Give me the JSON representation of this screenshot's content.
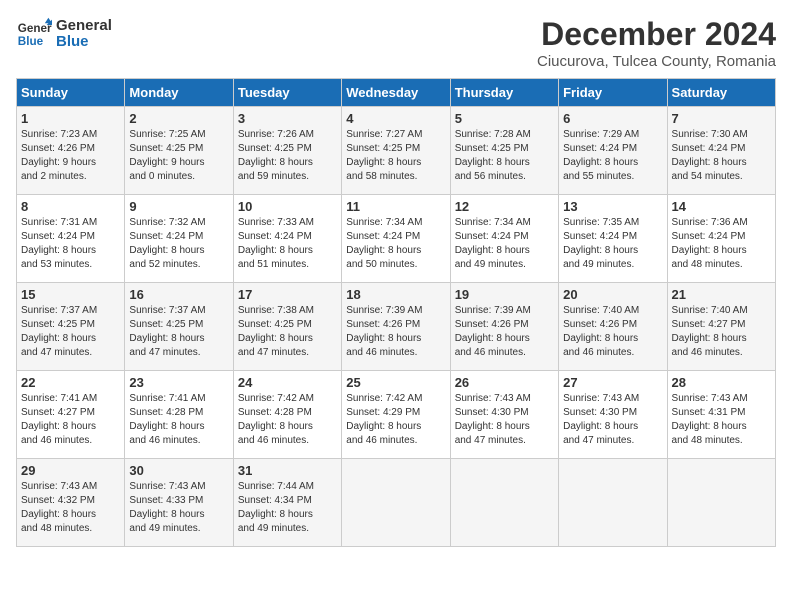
{
  "logo": {
    "text_general": "General",
    "text_blue": "Blue"
  },
  "header": {
    "title": "December 2024",
    "subtitle": "Ciucurova, Tulcea County, Romania"
  },
  "days_of_week": [
    "Sunday",
    "Monday",
    "Tuesday",
    "Wednesday",
    "Thursday",
    "Friday",
    "Saturday"
  ],
  "weeks": [
    [
      {
        "day": "1",
        "sunrise": "7:23 AM",
        "sunset": "4:26 PM",
        "daylight": "9 hours and 2 minutes."
      },
      {
        "day": "2",
        "sunrise": "7:25 AM",
        "sunset": "4:25 PM",
        "daylight": "9 hours and 0 minutes."
      },
      {
        "day": "3",
        "sunrise": "7:26 AM",
        "sunset": "4:25 PM",
        "daylight": "8 hours and 59 minutes."
      },
      {
        "day": "4",
        "sunrise": "7:27 AM",
        "sunset": "4:25 PM",
        "daylight": "8 hours and 58 minutes."
      },
      {
        "day": "5",
        "sunrise": "7:28 AM",
        "sunset": "4:25 PM",
        "daylight": "8 hours and 56 minutes."
      },
      {
        "day": "6",
        "sunrise": "7:29 AM",
        "sunset": "4:24 PM",
        "daylight": "8 hours and 55 minutes."
      },
      {
        "day": "7",
        "sunrise": "7:30 AM",
        "sunset": "4:24 PM",
        "daylight": "8 hours and 54 minutes."
      }
    ],
    [
      {
        "day": "8",
        "sunrise": "7:31 AM",
        "sunset": "4:24 PM",
        "daylight": "8 hours and 53 minutes."
      },
      {
        "day": "9",
        "sunrise": "7:32 AM",
        "sunset": "4:24 PM",
        "daylight": "8 hours and 52 minutes."
      },
      {
        "day": "10",
        "sunrise": "7:33 AM",
        "sunset": "4:24 PM",
        "daylight": "8 hours and 51 minutes."
      },
      {
        "day": "11",
        "sunrise": "7:34 AM",
        "sunset": "4:24 PM",
        "daylight": "8 hours and 50 minutes."
      },
      {
        "day": "12",
        "sunrise": "7:34 AM",
        "sunset": "4:24 PM",
        "daylight": "8 hours and 49 minutes."
      },
      {
        "day": "13",
        "sunrise": "7:35 AM",
        "sunset": "4:24 PM",
        "daylight": "8 hours and 49 minutes."
      },
      {
        "day": "14",
        "sunrise": "7:36 AM",
        "sunset": "4:24 PM",
        "daylight": "8 hours and 48 minutes."
      }
    ],
    [
      {
        "day": "15",
        "sunrise": "7:37 AM",
        "sunset": "4:25 PM",
        "daylight": "8 hours and 47 minutes."
      },
      {
        "day": "16",
        "sunrise": "7:37 AM",
        "sunset": "4:25 PM",
        "daylight": "8 hours and 47 minutes."
      },
      {
        "day": "17",
        "sunrise": "7:38 AM",
        "sunset": "4:25 PM",
        "daylight": "8 hours and 47 minutes."
      },
      {
        "day": "18",
        "sunrise": "7:39 AM",
        "sunset": "4:26 PM",
        "daylight": "8 hours and 46 minutes."
      },
      {
        "day": "19",
        "sunrise": "7:39 AM",
        "sunset": "4:26 PM",
        "daylight": "8 hours and 46 minutes."
      },
      {
        "day": "20",
        "sunrise": "7:40 AM",
        "sunset": "4:26 PM",
        "daylight": "8 hours and 46 minutes."
      },
      {
        "day": "21",
        "sunrise": "7:40 AM",
        "sunset": "4:27 PM",
        "daylight": "8 hours and 46 minutes."
      }
    ],
    [
      {
        "day": "22",
        "sunrise": "7:41 AM",
        "sunset": "4:27 PM",
        "daylight": "8 hours and 46 minutes."
      },
      {
        "day": "23",
        "sunrise": "7:41 AM",
        "sunset": "4:28 PM",
        "daylight": "8 hours and 46 minutes."
      },
      {
        "day": "24",
        "sunrise": "7:42 AM",
        "sunset": "4:28 PM",
        "daylight": "8 hours and 46 minutes."
      },
      {
        "day": "25",
        "sunrise": "7:42 AM",
        "sunset": "4:29 PM",
        "daylight": "8 hours and 46 minutes."
      },
      {
        "day": "26",
        "sunrise": "7:43 AM",
        "sunset": "4:30 PM",
        "daylight": "8 hours and 47 minutes."
      },
      {
        "day": "27",
        "sunrise": "7:43 AM",
        "sunset": "4:30 PM",
        "daylight": "8 hours and 47 minutes."
      },
      {
        "day": "28",
        "sunrise": "7:43 AM",
        "sunset": "4:31 PM",
        "daylight": "8 hours and 48 minutes."
      }
    ],
    [
      {
        "day": "29",
        "sunrise": "7:43 AM",
        "sunset": "4:32 PM",
        "daylight": "8 hours and 48 minutes."
      },
      {
        "day": "30",
        "sunrise": "7:43 AM",
        "sunset": "4:33 PM",
        "daylight": "8 hours and 49 minutes."
      },
      {
        "day": "31",
        "sunrise": "7:44 AM",
        "sunset": "4:34 PM",
        "daylight": "8 hours and 49 minutes."
      },
      null,
      null,
      null,
      null
    ]
  ]
}
